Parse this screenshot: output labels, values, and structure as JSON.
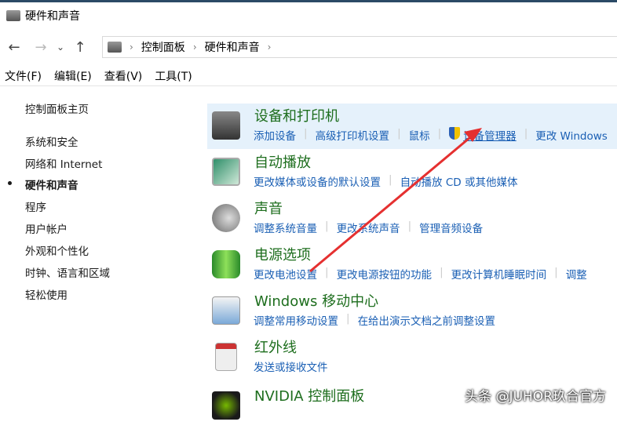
{
  "window": {
    "title": "硬件和声音"
  },
  "nav": {
    "back": "←",
    "forward": "→",
    "recent": "⌄",
    "up": "↑",
    "breadcrumb": [
      "控制面板",
      "硬件和声音"
    ],
    "sep": "›"
  },
  "menu": [
    "文件(F)",
    "编辑(E)",
    "查看(V)",
    "工具(T)"
  ],
  "sidebar": {
    "home": "控制面板主页",
    "items": [
      "系统和安全",
      "网络和 Internet",
      "硬件和声音",
      "程序",
      "用户帐户",
      "外观和个性化",
      "时钟、语言和区域",
      "轻松使用"
    ],
    "current": 2
  },
  "categories": [
    {
      "title": "设备和打印机",
      "links": [
        "添加设备",
        "高级打印机设置",
        "鼠标",
        "设备管理器",
        "更改 Windows"
      ]
    },
    {
      "title": "自动播放",
      "links": [
        "更改媒体或设备的默认设置",
        "自动播放 CD 或其他媒体"
      ]
    },
    {
      "title": "声音",
      "links": [
        "调整系统音量",
        "更改系统声音",
        "管理音频设备"
      ]
    },
    {
      "title": "电源选项",
      "links": [
        "更改电池设置",
        "更改电源按钮的功能",
        "更改计算机睡眠时间",
        "调整"
      ]
    },
    {
      "title": "Windows 移动中心",
      "links": [
        "调整常用移动设置",
        "在给出演示文档之前调整设置"
      ]
    },
    {
      "title": "红外线",
      "links": [
        "发送或接收文件"
      ]
    },
    {
      "title": "NVIDIA 控制面板",
      "links": []
    }
  ],
  "watermark": "头条 @JUHOR玖合官方",
  "colors": {
    "link": "#1a5fb4",
    "heading": "#1e6e1e",
    "highlight": "#e5f1fb",
    "arrow": "#e53030"
  }
}
